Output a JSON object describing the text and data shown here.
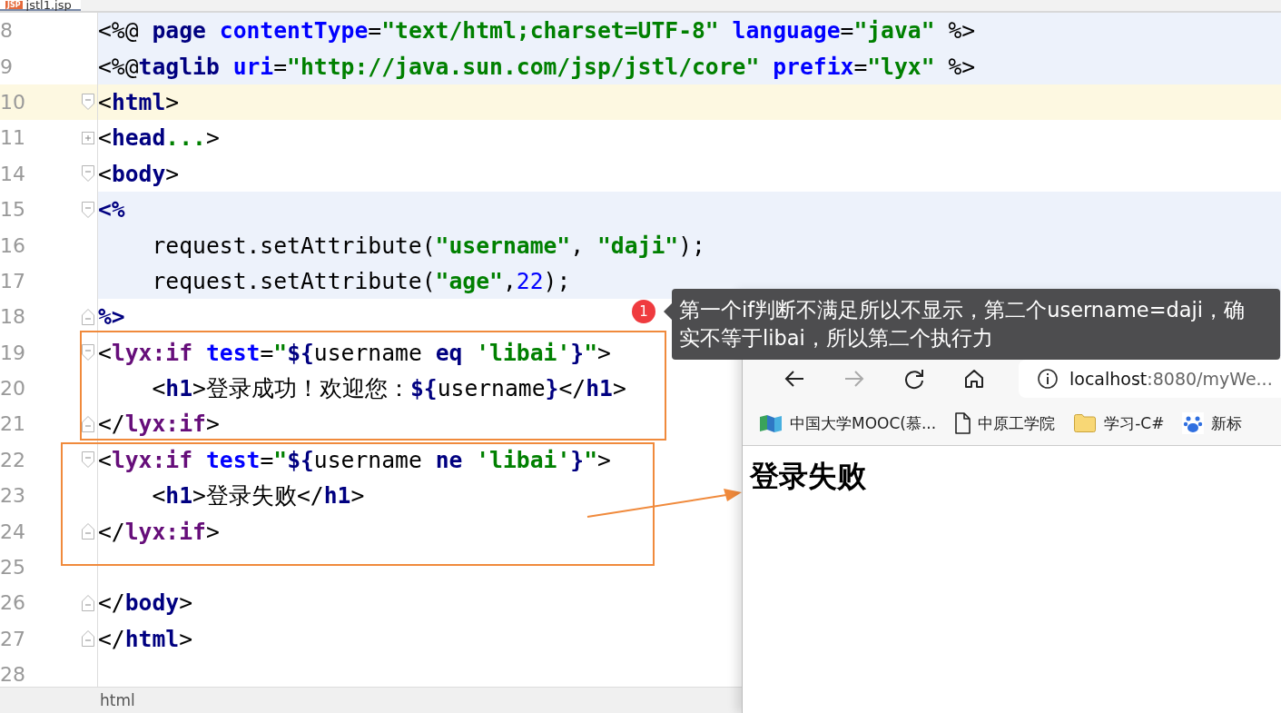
{
  "editor_tab": {
    "badge": "JSP",
    "label": "jstl1.jsp"
  },
  "code_lines": [
    {
      "number": "8",
      "current": false,
      "scriptlet": true,
      "tokens": [
        {
          "kind": "plain",
          "text": "<%@ "
        },
        {
          "kind": "tag",
          "text": "page "
        },
        {
          "kind": "attr",
          "text": "contentType"
        },
        {
          "kind": "plain",
          "text": "="
        },
        {
          "kind": "string",
          "text": "\"text/html;charset=UTF-8\" "
        },
        {
          "kind": "attr",
          "text": "language"
        },
        {
          "kind": "plain",
          "text": "="
        },
        {
          "kind": "string",
          "text": "\"java\""
        },
        {
          "kind": "plain",
          "text": " %>"
        }
      ]
    },
    {
      "number": "9",
      "current": false,
      "scriptlet": true,
      "tokens": [
        {
          "kind": "plain",
          "text": "<%@"
        },
        {
          "kind": "tag",
          "text": "taglib "
        },
        {
          "kind": "attr",
          "text": "uri"
        },
        {
          "kind": "plain",
          "text": "="
        },
        {
          "kind": "string",
          "text": "\"http://java.sun.com/jsp/jstl/core\" "
        },
        {
          "kind": "attr",
          "text": "prefix"
        },
        {
          "kind": "plain",
          "text": "="
        },
        {
          "kind": "string",
          "text": "\"lyx\""
        },
        {
          "kind": "plain",
          "text": " %>"
        }
      ]
    },
    {
      "number": "10",
      "fold": {
        "kind": "open"
      },
      "current": true,
      "scriptlet": false,
      "tokens": [
        {
          "kind": "plain",
          "text": "<"
        },
        {
          "kind": "tag",
          "text": "html"
        },
        {
          "kind": "plain",
          "text": ">"
        }
      ]
    },
    {
      "number": "11",
      "fold": {
        "kind": "collapsed"
      },
      "current": false,
      "scriptlet": false,
      "tokens": [
        {
          "kind": "plain",
          "text": "<"
        },
        {
          "kind": "tag",
          "text": "head"
        },
        {
          "kind": "string",
          "text": "..."
        },
        {
          "kind": "plain",
          "text": ">"
        }
      ]
    },
    {
      "number": "14",
      "fold": {
        "kind": "open"
      },
      "current": false,
      "scriptlet": false,
      "tokens": [
        {
          "kind": "plain",
          "text": "<"
        },
        {
          "kind": "tag",
          "text": "body"
        },
        {
          "kind": "plain",
          "text": ">"
        }
      ]
    },
    {
      "number": "15",
      "fold": {
        "kind": "open"
      },
      "current": false,
      "scriptlet": true,
      "tokens": [
        {
          "kind": "tag",
          "text": "<%"
        }
      ]
    },
    {
      "number": "16",
      "current": false,
      "scriptlet": true,
      "tokens": [
        {
          "kind": "plain",
          "text": "    request.setAttribute("
        },
        {
          "kind": "string",
          "text": "\"username\""
        },
        {
          "kind": "plain",
          "text": ", "
        },
        {
          "kind": "string",
          "text": "\"daji\""
        },
        {
          "kind": "plain",
          "text": ");"
        }
      ]
    },
    {
      "number": "17",
      "current": false,
      "scriptlet": true,
      "tokens": [
        {
          "kind": "plain",
          "text": "    request.setAttribute("
        },
        {
          "kind": "string",
          "text": "\"age\""
        },
        {
          "kind": "plain",
          "text": ","
        },
        {
          "kind": "number",
          "text": "22"
        },
        {
          "kind": "plain",
          "text": ");"
        }
      ]
    },
    {
      "number": "18",
      "fold": {
        "kind": "close"
      },
      "current": false,
      "scriptlet": false,
      "tokens": [
        {
          "kind": "tag",
          "text": "%>"
        }
      ]
    },
    {
      "number": "19",
      "fold": {
        "kind": "open"
      },
      "current": false,
      "scriptlet": false,
      "tokens": [
        {
          "kind": "plain",
          "text": "<"
        },
        {
          "kind": "custom",
          "text": "lyx:if "
        },
        {
          "kind": "attr",
          "text": "test"
        },
        {
          "kind": "plain",
          "text": "="
        },
        {
          "kind": "string",
          "text": "\""
        },
        {
          "kind": "tag",
          "text": "${"
        },
        {
          "kind": "plain",
          "text": "username "
        },
        {
          "kind": "tag",
          "text": "eq "
        },
        {
          "kind": "string",
          "text": "'libai'"
        },
        {
          "kind": "tag",
          "text": "}"
        },
        {
          "kind": "string",
          "text": "\""
        },
        {
          "kind": "plain",
          "text": ">"
        }
      ]
    },
    {
      "number": "20",
      "current": false,
      "scriptlet": false,
      "tokens": [
        {
          "kind": "plain",
          "text": "    <"
        },
        {
          "kind": "tag",
          "text": "h1"
        },
        {
          "kind": "plain",
          "text": ">登录成功！欢迎您："
        },
        {
          "kind": "tag",
          "text": "${"
        },
        {
          "kind": "plain",
          "text": "username"
        },
        {
          "kind": "tag",
          "text": "}"
        },
        {
          "kind": "plain",
          "text": "</"
        },
        {
          "kind": "tag",
          "text": "h1"
        },
        {
          "kind": "plain",
          "text": ">"
        }
      ]
    },
    {
      "number": "21",
      "fold": {
        "kind": "close"
      },
      "current": false,
      "scriptlet": false,
      "tokens": [
        {
          "kind": "plain",
          "text": "</"
        },
        {
          "kind": "custom",
          "text": "lyx:if"
        },
        {
          "kind": "plain",
          "text": ">"
        }
      ]
    },
    {
      "number": "22",
      "fold": {
        "kind": "open"
      },
      "current": false,
      "scriptlet": false,
      "tokens": [
        {
          "kind": "plain",
          "text": "<"
        },
        {
          "kind": "custom",
          "text": "lyx:if "
        },
        {
          "kind": "attr",
          "text": "test"
        },
        {
          "kind": "plain",
          "text": "="
        },
        {
          "kind": "string",
          "text": "\""
        },
        {
          "kind": "tag",
          "text": "${"
        },
        {
          "kind": "plain",
          "text": "username "
        },
        {
          "kind": "tag",
          "text": "ne "
        },
        {
          "kind": "string",
          "text": "'libai'"
        },
        {
          "kind": "tag",
          "text": "}"
        },
        {
          "kind": "string",
          "text": "\""
        },
        {
          "kind": "plain",
          "text": ">"
        }
      ]
    },
    {
      "number": "23",
      "current": false,
      "scriptlet": false,
      "tokens": [
        {
          "kind": "plain",
          "text": "    <"
        },
        {
          "kind": "tag",
          "text": "h1"
        },
        {
          "kind": "plain",
          "text": ">登录失败</"
        },
        {
          "kind": "tag",
          "text": "h1"
        },
        {
          "kind": "plain",
          "text": ">"
        }
      ]
    },
    {
      "number": "24",
      "fold": {
        "kind": "close"
      },
      "current": false,
      "scriptlet": false,
      "tokens": [
        {
          "kind": "plain",
          "text": "</"
        },
        {
          "kind": "custom",
          "text": "lyx:if"
        },
        {
          "kind": "plain",
          "text": ">"
        }
      ]
    },
    {
      "number": "25",
      "current": false,
      "scriptlet": false
    },
    {
      "number": "26",
      "fold": {
        "kind": "close"
      },
      "current": false,
      "scriptlet": false,
      "tokens": [
        {
          "kind": "plain",
          "text": "</"
        },
        {
          "kind": "tag",
          "text": "body"
        },
        {
          "kind": "plain",
          "text": ">"
        }
      ]
    },
    {
      "number": "27",
      "fold": {
        "kind": "close"
      },
      "current": false,
      "scriptlet": false,
      "tokens": [
        {
          "kind": "plain",
          "text": "</"
        },
        {
          "kind": "tag",
          "text": "html"
        },
        {
          "kind": "plain",
          "text": ">"
        }
      ]
    },
    {
      "number": "28",
      "current": false,
      "scriptlet": false
    }
  ],
  "status_bar": {
    "breadcrumb": "html"
  },
  "annotation": {
    "badge": "1",
    "tooltip": "第一个if判断不满足所以不显示，第二个username=daji，确实不等于libai，所以第二个执行力"
  },
  "browser": {
    "nav_buttons": [
      {
        "kind": "back",
        "disabled": false
      },
      {
        "kind": "forward",
        "disabled": true
      },
      {
        "kind": "refresh",
        "disabled": false
      },
      {
        "kind": "home",
        "disabled": false
      }
    ],
    "address": {
      "host": "localhost",
      "path": ":8080/myWe..."
    },
    "bookmarks": [
      {
        "kind": "mooc",
        "label": "中国大学MOOC(慕..."
      },
      {
        "kind": "page",
        "label": "中原工学院"
      },
      {
        "kind": "folder",
        "label": "学习-C#"
      },
      {
        "kind": "paw",
        "label": "新标"
      }
    ],
    "heading": "登录失败"
  }
}
